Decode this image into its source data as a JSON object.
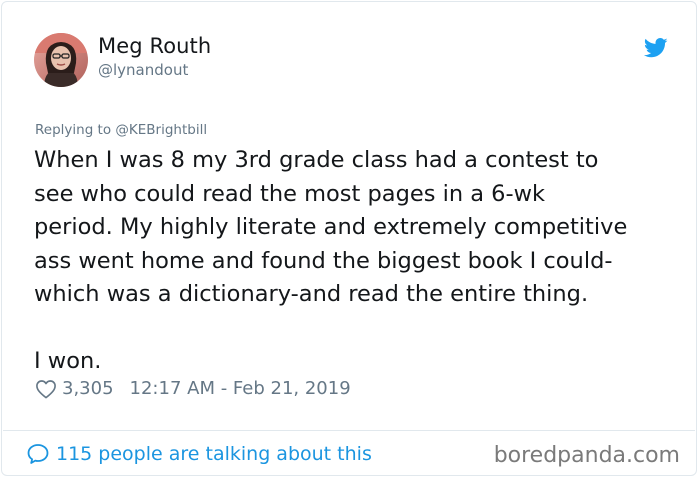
{
  "author": {
    "name": "Meg Routh",
    "handle": "@lynandout",
    "avatar_icon": "profile-photo"
  },
  "brand_icon": "twitter-bird-icon",
  "colors": {
    "twitter_blue": "#1da1f2",
    "link_blue": "#1b95e0",
    "meta_gray": "#657786",
    "text": "#14171a",
    "border": "#e1e8ed"
  },
  "tweet": {
    "replying_to": "Replying to @KEBrightbill",
    "lines": [
      "When I was 8 my 3rd grade class had a contest to",
      "see who could read the most pages in a 6-wk",
      "period. My highly literate and extremely competitive",
      "ass went home and found the biggest book I could-",
      "which was a dictionary-and read the entire thing."
    ],
    "closing": "I won.",
    "likes": "3,305",
    "timestamp": "12:17 AM - Feb 21, 2019"
  },
  "footer": {
    "talking": "115 people are talking about this",
    "watermark": "boredpanda.com"
  }
}
